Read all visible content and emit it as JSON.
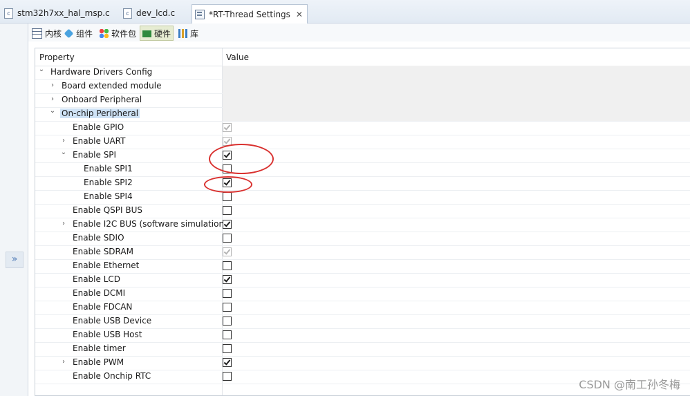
{
  "editor_tabs": [
    {
      "label": "stm32h7xx_hal_msp.c",
      "icon": "c-file-icon",
      "active": false
    },
    {
      "label": "dev_lcd.c",
      "icon": "c-file-icon",
      "active": false
    },
    {
      "label": "*RT-Thread Settings",
      "icon": "settings-icon",
      "active": true,
      "close": "✕"
    }
  ],
  "sub_tabs": [
    {
      "label": "内核",
      "icon": "kernel-icon"
    },
    {
      "label": "组件",
      "icon": "component-icon"
    },
    {
      "label": "软件包",
      "icon": "package-icon"
    },
    {
      "label": "硬件",
      "icon": "hardware-icon",
      "active": true
    },
    {
      "label": "库",
      "icon": "library-icon"
    }
  ],
  "expand_button": "»",
  "table": {
    "headers": {
      "property": "Property",
      "value": "Value"
    },
    "rows": [
      {
        "label": "Hardware Drivers Config",
        "expander": "down",
        "level": 0,
        "value": "group"
      },
      {
        "label": "Board extended module",
        "expander": "right",
        "level": 1,
        "value": "group"
      },
      {
        "label": "Onboard Peripheral",
        "expander": "right",
        "level": 1,
        "value": "group"
      },
      {
        "label": "On-chip Peripheral",
        "expander": "down",
        "level": 1,
        "value": "group",
        "selected": true
      },
      {
        "label": "Enable GPIO",
        "level": 2,
        "value": "checked-disabled"
      },
      {
        "label": "Enable UART",
        "expander": "right",
        "level": 2,
        "value": "checked-disabled"
      },
      {
        "label": "Enable SPI",
        "expander": "down",
        "level": 2,
        "value": "checked"
      },
      {
        "label": "Enable SPI1",
        "level": 3,
        "value": "unchecked"
      },
      {
        "label": "Enable SPI2",
        "level": 3,
        "value": "checked"
      },
      {
        "label": "Enable SPI4",
        "level": 3,
        "value": "unchecked"
      },
      {
        "label": "Enable QSPI BUS",
        "level": 2,
        "value": "unchecked"
      },
      {
        "label": "Enable I2C BUS (software simulation)",
        "expander": "right",
        "level": 2,
        "value": "checked"
      },
      {
        "label": "Enable SDIO",
        "level": 2,
        "value": "unchecked"
      },
      {
        "label": "Enable SDRAM",
        "level": 2,
        "value": "checked-disabled"
      },
      {
        "label": "Enable Ethernet",
        "level": 2,
        "value": "unchecked"
      },
      {
        "label": "Enable LCD",
        "level": 2,
        "value": "checked"
      },
      {
        "label": "Enable DCMI",
        "level": 2,
        "value": "unchecked"
      },
      {
        "label": "Enable FDCAN",
        "level": 2,
        "value": "unchecked"
      },
      {
        "label": "Enable USB Device",
        "level": 2,
        "value": "unchecked"
      },
      {
        "label": "Enable USB Host",
        "level": 2,
        "value": "unchecked"
      },
      {
        "label": "Enable timer",
        "level": 2,
        "value": "unchecked"
      },
      {
        "label": "Enable PWM",
        "expander": "right",
        "level": 2,
        "value": "checked"
      },
      {
        "label": "Enable Onchip RTC",
        "level": 2,
        "value": "unchecked"
      }
    ]
  },
  "annotation_color": "#d9312f",
  "watermark": "CSDN @南工孙冬梅"
}
